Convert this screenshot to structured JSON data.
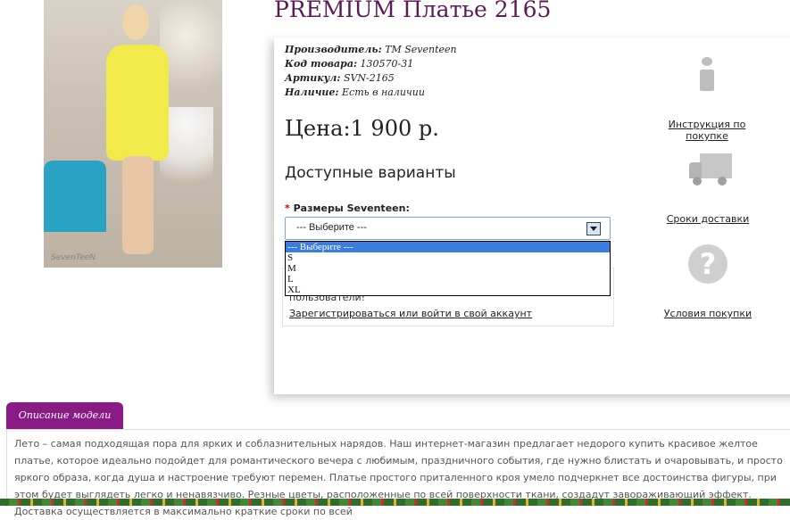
{
  "product": {
    "title": "PREMIUM Платье 2165",
    "photo_watermark": "SevenTeeN",
    "specs": [
      {
        "label": "Производитель:",
        "value": "TM Seventeen"
      },
      {
        "label": "Код товара:",
        "value": "130570-31"
      },
      {
        "label": "Артикул:",
        "value": "SVN-2165"
      },
      {
        "label": "Наличие:",
        "value": "Есть в наличии"
      }
    ],
    "price": "Цена:1 900 р.",
    "variants_heading": "Доступные варианты",
    "size_label_star": "*",
    "size_label": "Размеры Seventeen:",
    "size_select_value": "--- Выберите ---",
    "size_options": [
      "--- Выберите ---",
      "S",
      "M",
      "L",
      "XL"
    ],
    "login_text": "пользователи!",
    "login_link": "Зарегистрироваться или войти в свой аккаунт"
  },
  "sidebar": {
    "instructions_link": "Инструкция по покупке",
    "delivery_link": "Сроки доставки",
    "terms_link": "Условия покупки"
  },
  "description": {
    "tab_label": "Описание модели",
    "text": "Лето – самая подходящая пора для ярких и соблазнительных нарядов. Наш интернет-магазин предлагает недорого купить красивое желтое платье, которое идеально подойдет для романтического вечера с любимым, праздничного события, где нужно блистать и очаровывать, и просто яркого образа, когда душа и настроение требуют перемен. Платье простого приталенного кроя умело подчеркнет все достоинства фигуры, при этом будет выглядеть легко и ненавязчиво. Резные цветы, расположенные по всей поверхности ткани, создадут завораживающий эффект. Доставка осуществляется в максимально краткие сроки по всей"
  },
  "colors": {
    "title": "#5b1b57",
    "tab_bg": "#8a1a86",
    "option_selected": "#3a7de0"
  }
}
